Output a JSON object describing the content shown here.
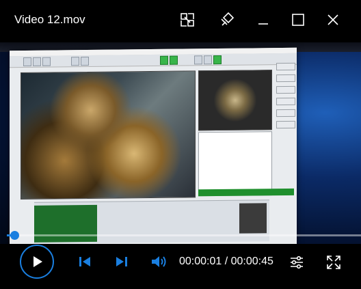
{
  "window": {
    "title": "Video 12.mov",
    "buttons": [
      "snap-icon",
      "pin-icon",
      "minimize-icon",
      "maximize-icon",
      "close-icon"
    ]
  },
  "player": {
    "current_time": "00:00:01",
    "separator": " / ",
    "duration": "00:00:45",
    "progress": 0.022,
    "controls": [
      "play-icon",
      "previous-icon",
      "next-icon",
      "volume-icon",
      "settings-icon",
      "fullscreen-icon"
    ],
    "accent_color": "#1a7fe0"
  }
}
